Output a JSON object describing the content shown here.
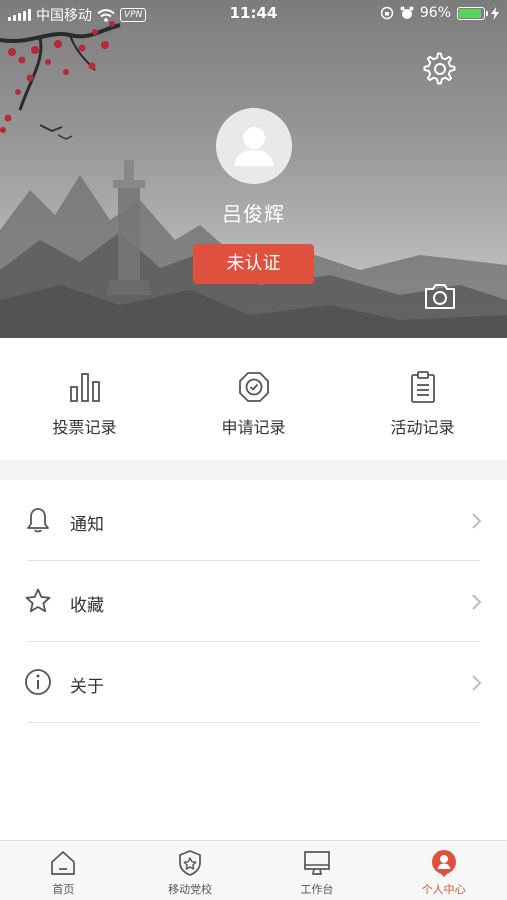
{
  "status_bar": {
    "carrier": "中国移动",
    "vpn": "VPN",
    "time": "11:44",
    "battery": "96%",
    "battery_level": 0.96
  },
  "profile": {
    "username": "吕俊辉",
    "cert_status": "未认证"
  },
  "records": [
    {
      "label": "投票记录",
      "icon": "bar-chart-icon"
    },
    {
      "label": "申请记录",
      "icon": "badge-check-icon"
    },
    {
      "label": "活动记录",
      "icon": "clipboard-icon"
    }
  ],
  "menu": [
    {
      "label": "通知",
      "icon": "bell-icon"
    },
    {
      "label": "收藏",
      "icon": "star-icon"
    },
    {
      "label": "关于",
      "icon": "info-icon"
    }
  ],
  "tabs": [
    {
      "label": "首页",
      "icon": "home-icon",
      "active": false
    },
    {
      "label": "移动党校",
      "icon": "shield-star-icon",
      "active": false
    },
    {
      "label": "工作台",
      "icon": "monitor-icon",
      "active": false
    },
    {
      "label": "个人中心",
      "icon": "person-icon",
      "active": true
    }
  ],
  "colors": {
    "accent": "#e0503f",
    "divider": "#e3e3e3",
    "section_gap": "#f4f4f4"
  }
}
